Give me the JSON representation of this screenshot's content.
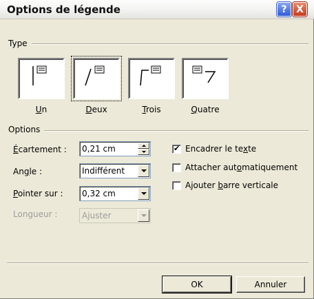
{
  "dialog": {
    "title": "Options de légende",
    "help_glyph": "?",
    "close_glyph": "X"
  },
  "type_group": {
    "label": "Type",
    "options": [
      {
        "id": "un",
        "label_u": "U",
        "label_rest": "n",
        "selected": false
      },
      {
        "id": "deux",
        "label_u": "D",
        "label_rest": "eux",
        "selected": true
      },
      {
        "id": "trois",
        "label_u": "T",
        "label_rest": "rois",
        "selected": false
      },
      {
        "id": "quatre",
        "label_u": "Q",
        "label_rest": "uatre",
        "selected": false
      }
    ]
  },
  "options_group": {
    "label": "Options",
    "ecartement": {
      "label_pre": "",
      "label_u": "É",
      "label_post": "cartement :",
      "value": "0,21 cm"
    },
    "angle": {
      "label_pre": "An",
      "label_u": "g",
      "label_post": "le :",
      "value": "Indifférent"
    },
    "pointer": {
      "label_pre": "",
      "label_u": "P",
      "label_post": "ointer sur :",
      "value": "0,32 cm"
    },
    "longueur": {
      "label": "Longueur :",
      "value": "Ajuster",
      "disabled": true
    }
  },
  "checkboxes": [
    {
      "label_pre": "Encadrer le te",
      "label_u": "x",
      "label_post": "te",
      "checked": true
    },
    {
      "label_pre": "Attacher aut",
      "label_u": "o",
      "label_post": "matiquement",
      "checked": false
    },
    {
      "label_pre": "Ajouter ",
      "label_u": "b",
      "label_post": "arre verticale",
      "checked": false
    }
  ],
  "buttons": {
    "ok": "OK",
    "cancel": "Annuler"
  },
  "check_glyph": "✔"
}
